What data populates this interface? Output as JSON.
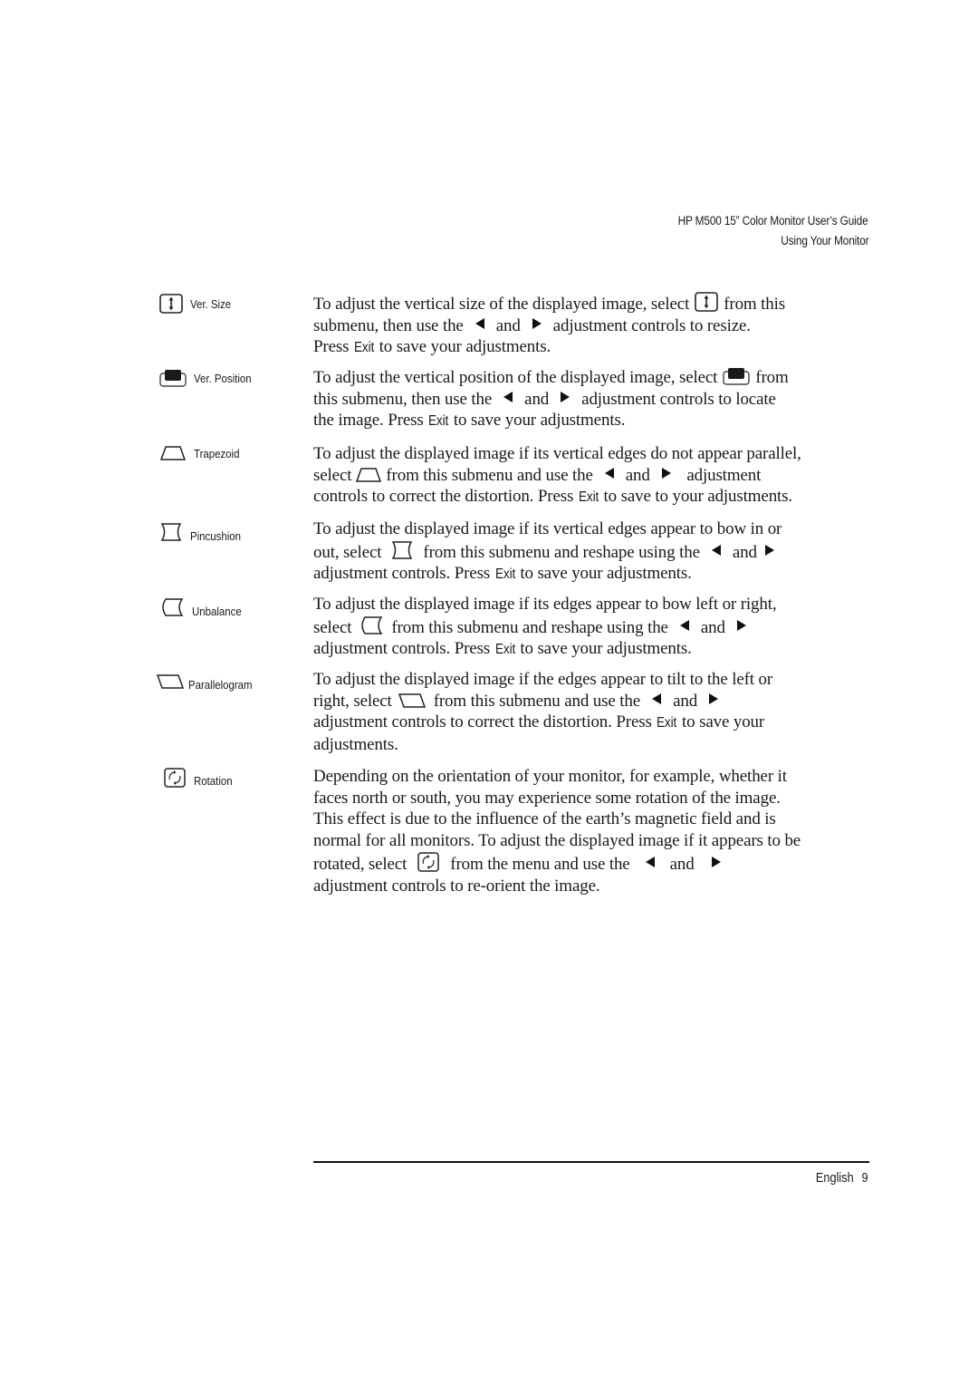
{
  "header": {
    "title": "HP M500 15” Color Monitor User’s Guide",
    "subtitle": "Using Your Monitor"
  },
  "exit_label": "Exit",
  "and": "and",
  "sections": [
    {
      "icon": "vertical-size-icon",
      "label": "Ver. Size",
      "lines": [
        [
          "To adjust the vertical size of the displayed image, select",
          "from this"
        ],
        [
          "submenu, then use the",
          "adjustment controls to resize."
        ],
        [
          "Press",
          "to save your adjustments."
        ]
      ]
    },
    {
      "icon": "vertical-position-icon",
      "label": "Ver. Position",
      "lines": [
        [
          "To adjust the vertical position of the displayed image, select",
          "from"
        ],
        [
          "this submenu, then use the",
          "adjustment controls to locate"
        ],
        [
          "the image. Press",
          "to save your adjustments."
        ]
      ]
    },
    {
      "icon": "trapezoid-icon",
      "label": "Trapezoid",
      "lines": [
        [
          "To adjust the displayed image if its vertical edges do not appear parallel,"
        ],
        [
          "select",
          "from this submenu and use the",
          "adjustment"
        ],
        [
          "controls to correct the distortion. Press",
          "to save to your adjustments."
        ]
      ]
    },
    {
      "icon": "pincushion-icon",
      "label": "Pincushion",
      "lines": [
        [
          "To adjust the displayed image if its vertical edges appear to bow in or"
        ],
        [
          "out, select",
          "from this submenu and reshape using the"
        ],
        [
          "adjustment controls. Press",
          "to save your adjustments."
        ]
      ]
    },
    {
      "icon": "unbalance-icon",
      "label": "Unbalance",
      "lines": [
        [
          "To adjust the displayed image if its edges appear to bow left or right,"
        ],
        [
          "select",
          "from this submenu and reshape using the"
        ],
        [
          "adjustment controls. Press",
          "to save your adjustments."
        ]
      ]
    },
    {
      "icon": "parallelogram-icon",
      "label": "Parallelogram",
      "lines": [
        [
          "To adjust the displayed image if the edges appear to tilt to the left or"
        ],
        [
          "right, select",
          "from this submenu and use the"
        ],
        [
          "adjustment controls to correct the distortion. Press",
          "to save your"
        ],
        [
          "adjustments."
        ]
      ]
    },
    {
      "icon": "rotation-icon",
      "label": "Rotation",
      "lines": [
        [
          "Depending on the orientation of your monitor, for example, whether it"
        ],
        [
          "faces north or south, you may experience some rotation of the image."
        ],
        [
          "This effect is due to the influence of the earth’s magnetic field and is"
        ],
        [
          "normal for all monitors. To adjust the displayed image if it appears to be"
        ],
        [
          "rotated, select",
          "from the menu and use the"
        ],
        [
          "adjustment controls to re-orient the image."
        ]
      ]
    }
  ],
  "footer": {
    "language": "English",
    "page_number": "9"
  }
}
